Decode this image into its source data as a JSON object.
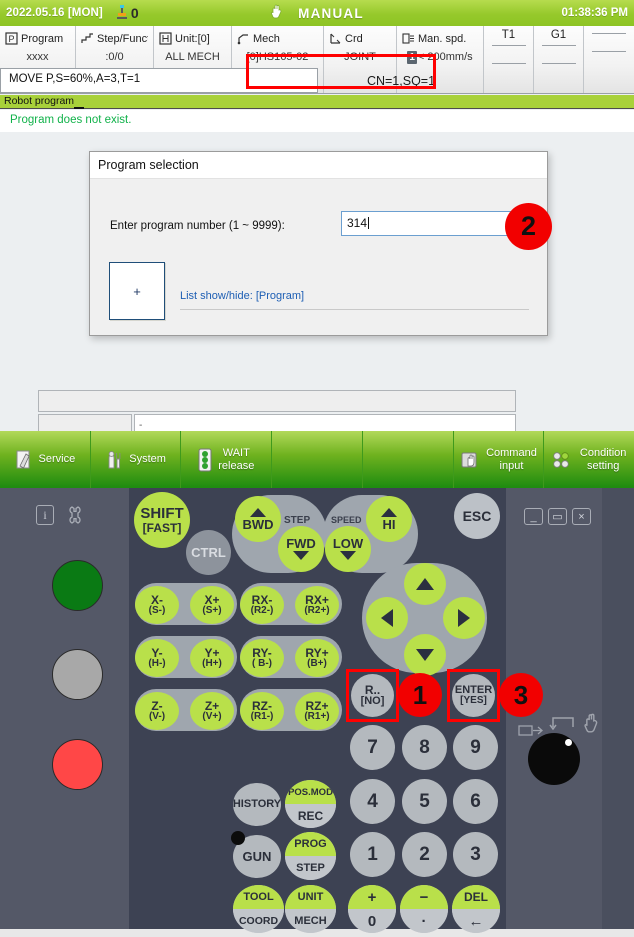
{
  "titlebar": {
    "date": "2022.05.16 [MON]",
    "robot_count": "0",
    "mode": "MANUAL",
    "time": "01:38:36 PM",
    "hand_icon": "hand-icon",
    "robot_icon": "robot-icon"
  },
  "status_cells": [
    {
      "icon": "program-icon",
      "label": "Program",
      "value": "xxxx"
    },
    {
      "icon": "step-icon",
      "label": "Step/Function",
      "value": ":0/0"
    },
    {
      "icon": "unit-icon",
      "label": "Unit:[0]",
      "value": "ALL MECH"
    },
    {
      "icon": "mech-icon",
      "label": "Mech",
      "value": "[0]HS165-02"
    },
    {
      "icon": "crd-icon",
      "label": "Crd",
      "value": "JOINT"
    },
    {
      "icon": "speed-icon",
      "label": "Man. spd.",
      "value": "200mm/s",
      "badge": "1",
      "prefix": "<"
    }
  ],
  "tool_cells": [
    {
      "label": "T1"
    },
    {
      "label": "G1"
    },
    {
      "label": ""
    }
  ],
  "command_line": "MOVE P,S=60%,A=3,T=1",
  "cn_sq": "CN=1,SQ=1",
  "program_bar": "Robot program",
  "message": "Program does not exist.",
  "dialog": {
    "title": "Program selection",
    "field_label": "Enter program number (1 ~ 9999):",
    "field_value": "314",
    "plus_button": "+",
    "list_link": "List show/hide: [Program]"
  },
  "editor": {
    "line_value": "",
    "prompt_value": "-"
  },
  "badges": {
    "one": "1",
    "two": "2",
    "three": "3"
  },
  "function_toolbar": [
    {
      "label": "Service",
      "icon": "service-pencil-icon"
    },
    {
      "label": "System",
      "icon": "system-tools-icon"
    },
    {
      "label": "WAIT\nrelease",
      "icon": "traffic-light-icon"
    },
    {
      "label": "",
      "icon": ""
    },
    {
      "label": "",
      "icon": ""
    },
    {
      "label": "Command\ninput",
      "icon": "command-hand-icon"
    },
    {
      "label": "Condition\nsetting",
      "icon": "condition-dots-icon"
    }
  ],
  "pendant": {
    "info_icon": "info-icon",
    "wrench_icon": "wrench-icon",
    "lamps": [
      {
        "name": "lamp-green",
        "color": "#0a7a14"
      },
      {
        "name": "lamp-gray",
        "color": "#a8a8a8"
      },
      {
        "name": "lamp-red",
        "color": "#ff4747"
      }
    ],
    "window_buttons": [
      {
        "name": "minimize-button",
        "glyph": "_"
      },
      {
        "name": "restore-button",
        "glyph": "▭"
      },
      {
        "name": "close-button",
        "glyph": "×"
      }
    ],
    "keys": {
      "shift": {
        "line1": "SHIFT",
        "line2": "[FAST]"
      },
      "ctrl": {
        "line1": "CTRL"
      },
      "bwd": {
        "line1": "BWD"
      },
      "fwd": {
        "line1": "FWD"
      },
      "step": {
        "line1": "STEP"
      },
      "speed": {
        "line1": "SPEED"
      },
      "hi": {
        "line1": "HI"
      },
      "low": {
        "line1": "LOW"
      },
      "esc": {
        "line1": "ESC"
      },
      "r_no": {
        "line1": "R..",
        "line2": "[NO]"
      },
      "enter": {
        "line1": "ENTER",
        "line2": "[YES]"
      }
    },
    "axis_keys": [
      {
        "line1": "X-",
        "line2": "(S-)"
      },
      {
        "line1": "X+",
        "line2": "(S+)"
      },
      {
        "line1": "RX-",
        "line2": "(R2-)"
      },
      {
        "line1": "RX+",
        "line2": "(R2+)"
      },
      {
        "line1": "Y-",
        "line2": "(H-)"
      },
      {
        "line1": "Y+",
        "line2": "(H+)"
      },
      {
        "line1": "RY-",
        "line2": "( B-)"
      },
      {
        "line1": "RY+",
        "line2": "(B+)"
      },
      {
        "line1": "Z-",
        "line2": "(V-)"
      },
      {
        "line1": "Z+",
        "line2": "(V+)"
      },
      {
        "line1": "RZ-",
        "line2": "(R1-)"
      },
      {
        "line1": "RZ+",
        "line2": "(R1+)"
      }
    ],
    "numpad": [
      "7",
      "8",
      "9",
      "4",
      "5",
      "6",
      "1",
      "2",
      "3"
    ],
    "function_keys": [
      {
        "top": "",
        "bot": "HISTORY"
      },
      {
        "top": "POS.MOD",
        "bot": "REC"
      },
      {
        "top": "",
        "bot": "GUN"
      },
      {
        "top": "PROG",
        "bot": "STEP"
      },
      {
        "top": "TOOL",
        "bot": "COORD"
      },
      {
        "top": "UNIT",
        "bot": "MECH"
      }
    ],
    "bottom_keys": [
      {
        "top": "+",
        "bot": "0"
      },
      {
        "top": "−",
        "bot": "·"
      },
      {
        "top": "DEL",
        "bot": "←"
      }
    ],
    "dpad": [
      "up-arrow",
      "left-arrow",
      "right-arrow",
      "down-arrow"
    ]
  }
}
